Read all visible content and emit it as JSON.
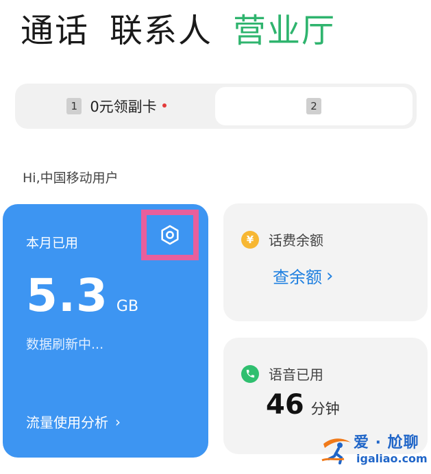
{
  "top_tabs": [
    {
      "label": "通话"
    },
    {
      "label": "联系人"
    },
    {
      "label": "营业厅"
    }
  ],
  "active_tab_color": "#2fb46e",
  "sim_selector": {
    "sim1": {
      "number": "1",
      "label": "0元领副卡",
      "has_dot": true
    },
    "sim2": {
      "number": "2"
    }
  },
  "greeting": "Hi,中国移动用户",
  "data_card": {
    "title": "本月已用",
    "value": "5.3",
    "unit": "GB",
    "status": "数据刷新中...",
    "link": "流量使用分析",
    "settings_icon": "settings-icon",
    "color": "#3d95f2",
    "highlight_color": "#e85f9c"
  },
  "balance_card": {
    "title": "话费余额",
    "link": "查余额",
    "icon": "yuan-coin-icon",
    "icon_glyph": "¥",
    "link_color": "#1e7fe0"
  },
  "voice_card": {
    "title": "语音已用",
    "value": "46",
    "unit": "分钟",
    "icon": "phone-icon"
  },
  "watermark": {
    "text": "爱 · 尬聊",
    "url": "igaliao.com"
  }
}
